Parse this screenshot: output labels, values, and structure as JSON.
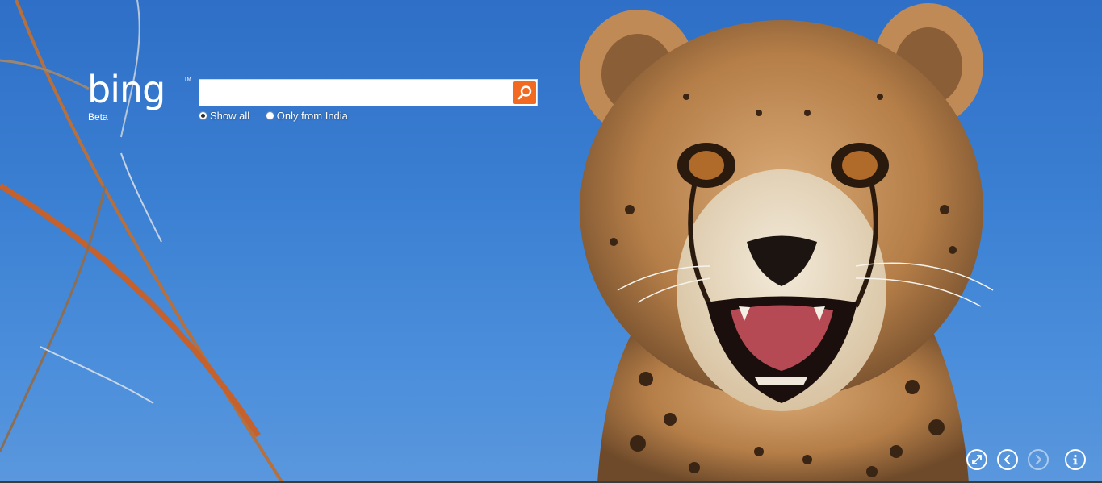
{
  "logo": {
    "wordmark": "bing",
    "tm": "TM",
    "tag": "Beta"
  },
  "search": {
    "value": "",
    "placeholder": "",
    "button_icon": "magnifier-icon"
  },
  "scope": [
    {
      "label": "Show all",
      "selected": true
    },
    {
      "label": "Only from India",
      "selected": false
    }
  ],
  "controls": [
    {
      "name": "fullscreen-icon",
      "enabled": true
    },
    {
      "name": "previous-image-icon",
      "enabled": true
    },
    {
      "name": "next-image-icon",
      "enabled": false
    },
    {
      "name": "info-icon",
      "enabled": true
    }
  ],
  "colors": {
    "accent": "#f26a21",
    "sky": "#3a7fd2"
  }
}
